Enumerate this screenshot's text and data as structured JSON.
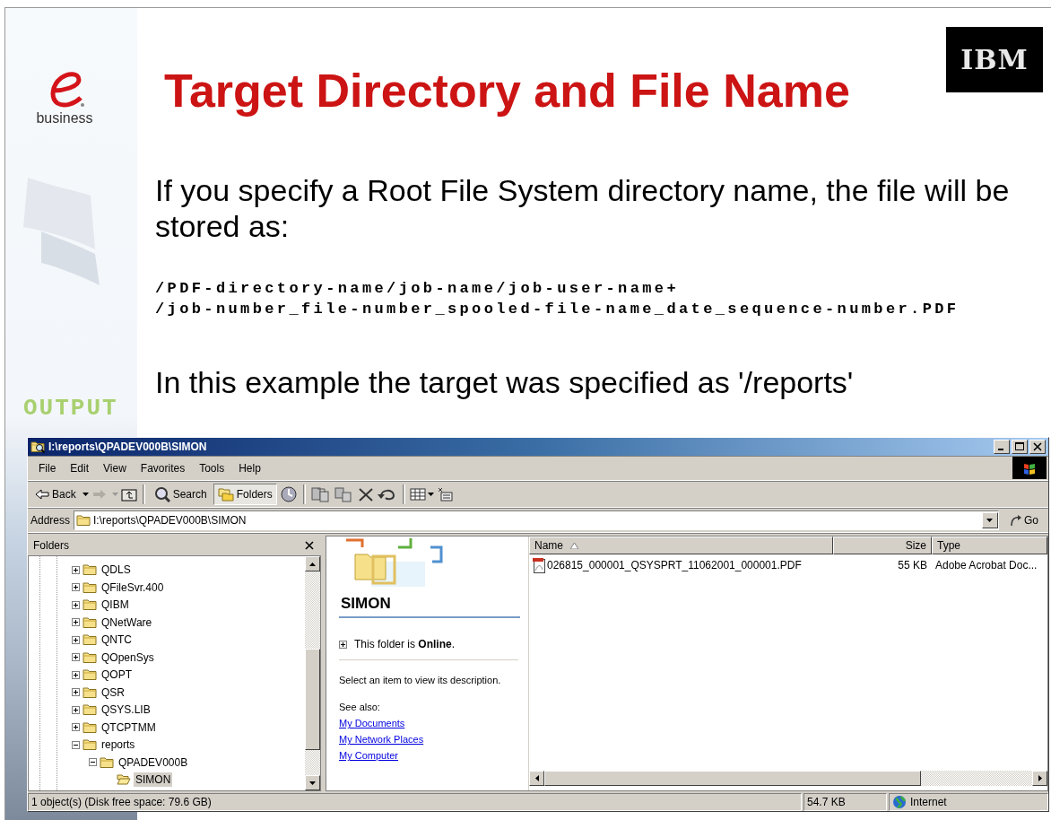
{
  "slide": {
    "logo_text": "business",
    "title": "Target Directory and File Name",
    "brand": "IBM",
    "banner_text": "OUTPUT",
    "paragraph": "If you specify a Root File System directory name, the file will be stored as:",
    "code_lines": [
      "/PDF-directory-name/job-name/job-user-name+",
      "/job-number_file-number_spooled-file-name_date_sequence-number.PDF"
    ],
    "example": "In this example the target was specified as '/reports'"
  },
  "window": {
    "title": "I:\\reports\\QPADEV000B\\SIMON",
    "menu": [
      "File",
      "Edit",
      "View",
      "Favorites",
      "Tools",
      "Help"
    ],
    "toolbar": [
      {
        "label": "Back",
        "pressed": false
      },
      {
        "label": "Search",
        "pressed": false
      },
      {
        "label": "Folders",
        "pressed": true
      }
    ],
    "address": {
      "label": "Address",
      "value": "I:\\reports\\QPADEV000B\\SIMON",
      "go": "Go"
    },
    "folders_pane": {
      "title": "Folders",
      "tree": [
        {
          "label": "QDLS",
          "expander": true,
          "expanded": false,
          "selected": false
        },
        {
          "label": "QFileSvr.400",
          "expander": true,
          "expanded": false,
          "selected": false
        },
        {
          "label": "QIBM",
          "expander": true,
          "expanded": false,
          "selected": false
        },
        {
          "label": "QNetWare",
          "expander": true,
          "expanded": false,
          "selected": false
        },
        {
          "label": "QNTC",
          "expander": true,
          "expanded": false,
          "selected": false
        },
        {
          "label": "QOpenSys",
          "expander": true,
          "expanded": false,
          "selected": false
        },
        {
          "label": "QOPT",
          "expander": true,
          "expanded": false,
          "selected": false
        },
        {
          "label": "QSR",
          "expander": true,
          "expanded": false,
          "selected": false
        },
        {
          "label": "QSYS.LIB",
          "expander": true,
          "expanded": false,
          "selected": false
        },
        {
          "label": "QTCPTMM",
          "expander": true,
          "expanded": false,
          "selected": false
        },
        {
          "label": "reports",
          "expander": true,
          "expanded": true,
          "selected": false,
          "children": [
            {
              "label": "QPADEV000B",
              "expander": true,
              "expanded": true,
              "selected": false,
              "children": [
                {
                  "label": "SIMON",
                  "expander": false,
                  "selected": true
                }
              ]
            }
          ]
        }
      ]
    },
    "info_pane": {
      "heading": "SIMON",
      "status": "This folder is **Online**.",
      "hint": "Select an item to view its description.",
      "see_also": "See also:",
      "links": [
        "My Documents",
        "My Network Places",
        "My Computer"
      ]
    },
    "file_list": {
      "columns": [
        {
          "label": "Name",
          "sorted": true
        },
        {
          "label": "Size",
          "sorted": false
        },
        {
          "label": "Type",
          "sorted": false
        }
      ],
      "rows": [
        {
          "name": "026815_000001_QSYSPRT_11062001_000001.PDF",
          "size": "55 KB",
          "type": "Adobe Acrobat Doc..."
        }
      ]
    },
    "status_bar": {
      "objects": "1 object(s) (Disk free space: 79.6 GB)",
      "size": "54.7 KB",
      "zone": "Internet"
    }
  }
}
